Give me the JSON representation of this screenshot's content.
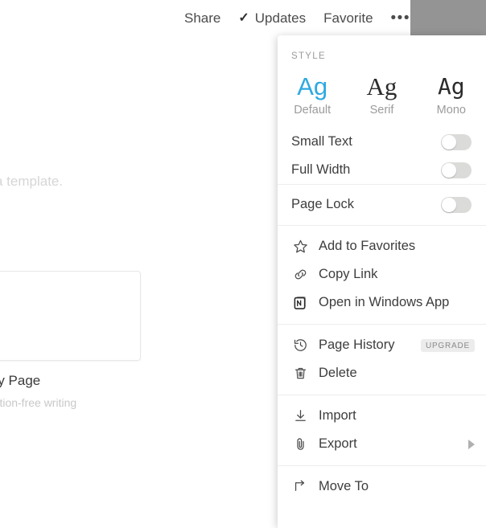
{
  "topbar": {
    "items": [
      {
        "label": "Share",
        "icon": null,
        "name": "share-button"
      },
      {
        "label": "Updates",
        "icon": "check-icon",
        "name": "updates-button"
      },
      {
        "label": "Favorite",
        "icon": null,
        "name": "favorite-button"
      },
      {
        "label": "•••",
        "icon": "more-icon",
        "name": "more-options-button"
      }
    ],
    "avatar_color": "#949494"
  },
  "background": {
    "template_text": "a template.",
    "card_title": "mpty Page",
    "card_subtitle": "istraction-free writing"
  },
  "menu": {
    "style_section_label": "STYLE",
    "fonts": [
      {
        "sample": "Ag",
        "name": "Default",
        "selected": true
      },
      {
        "sample": "Ag",
        "name": "Serif",
        "selected": false
      },
      {
        "sample": "Ag",
        "name": "Mono",
        "selected": false
      }
    ],
    "toggles": [
      {
        "label": "Small Text",
        "on": false
      },
      {
        "label": "Full Width",
        "on": false
      },
      {
        "label": "Page Lock",
        "on": false
      }
    ],
    "actions_group_1": [
      {
        "label": "Add to Favorites",
        "icon": "star-icon"
      },
      {
        "label": "Copy Link",
        "icon": "link-icon"
      },
      {
        "label": "Open in Windows App",
        "icon": "notion-logo-icon"
      }
    ],
    "actions_group_2": [
      {
        "label": "Page History",
        "icon": "history-icon",
        "badge": "UPGRADE"
      },
      {
        "label": "Delete",
        "icon": "trash-icon",
        "badge": null
      }
    ],
    "actions_group_3": [
      {
        "label": "Import",
        "icon": "download-icon",
        "submenu": false
      },
      {
        "label": "Export",
        "icon": "paperclip-icon",
        "submenu": true
      }
    ],
    "actions_group_4": [
      {
        "label": "Move To",
        "icon": "move-arrow-icon",
        "submenu": false
      }
    ]
  },
  "colors": {
    "accent": "#2ea9e0",
    "text": "#3d3d3d",
    "muted": "#9b9b9b",
    "divider": "#ededed",
    "badge_bg": "#ececec"
  }
}
